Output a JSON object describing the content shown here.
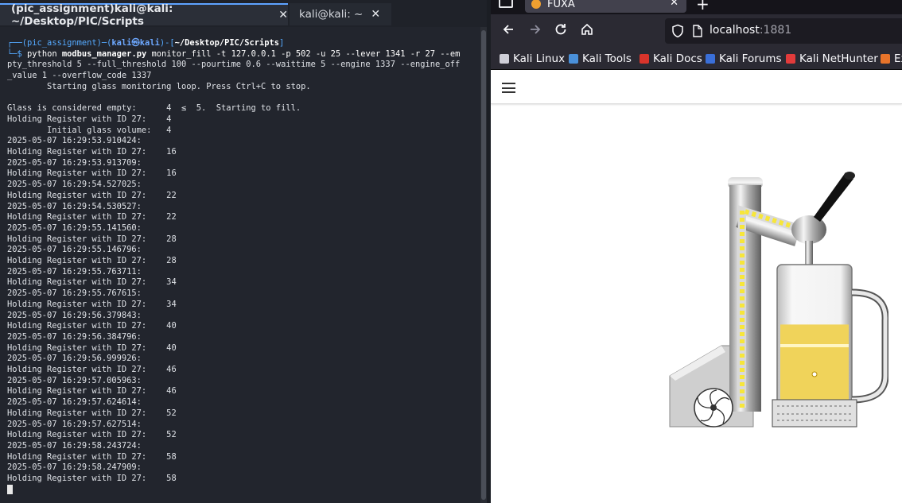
{
  "terminal": {
    "tabs": [
      {
        "label": "(pic_assignment)kali@kali: ~/Desktop/PIC/Scripts",
        "close": "✕"
      },
      {
        "label": "kali@kali: ~",
        "close": "✕"
      }
    ],
    "prompt": {
      "venv": "(pic_assignment)",
      "user": "kali㉿kali",
      "path": "~/Desktop/PIC/Scripts",
      "symbol": "$",
      "command_bin": "python",
      "command_script": "modbus_manager.py",
      "command_args_line1": " monitor_fill -t 127.0.0.1 -p 502 -u 25 --lever 1341 -r 27 --em",
      "command_line2": "pty_threshold 5 --full_threshold 100 --pourtime 0.6 --waittime 5 --engine 1337 --engine_off",
      "command_line3": "_value 1 --overflow_code 1337"
    },
    "output": [
      "        Starting glass monitoring loop. Press Ctrl+C to stop.",
      "",
      "Glass is considered empty:      4  ≤  5.  Starting to fill.",
      "Holding Register with ID 27:    4",
      "        Initial glass volume:   4",
      "2025-05-07 16:29:53.910424:",
      "Holding Register with ID 27:    16",
      "2025-05-07 16:29:53.913709:",
      "Holding Register with ID 27:    16",
      "2025-05-07 16:29:54.527025:",
      "Holding Register with ID 27:    22",
      "2025-05-07 16:29:54.530527:",
      "Holding Register with ID 27:    22",
      "2025-05-07 16:29:55.141560:",
      "Holding Register with ID 27:    28",
      "2025-05-07 16:29:55.146796:",
      "Holding Register with ID 27:    28",
      "2025-05-07 16:29:55.763711:",
      "Holding Register with ID 27:    34",
      "2025-05-07 16:29:55.767615:",
      "Holding Register with ID 27:    34",
      "2025-05-07 16:29:56.379843:",
      "Holding Register with ID 27:    40",
      "2025-05-07 16:29:56.384796:",
      "Holding Register with ID 27:    40",
      "2025-05-07 16:29:56.999926:",
      "Holding Register with ID 27:    46",
      "2025-05-07 16:29:57.005963:",
      "Holding Register with ID 27:    46",
      "2025-05-07 16:29:57.624614:",
      "Holding Register with ID 27:    52",
      "2025-05-07 16:29:57.627514:",
      "Holding Register with ID 27:    52",
      "2025-05-07 16:29:58.243724:",
      "Holding Register with ID 27:    58",
      "2025-05-07 16:29:58.247909:",
      "Holding Register with ID 27:    58"
    ]
  },
  "browser": {
    "tab_title": "FUXA",
    "tab_close": "✕",
    "new_tab": "+",
    "url_host": "localhost",
    "url_port": ":1881",
    "bookmarks": [
      {
        "label": "Kali Linux",
        "icon": "kali-dragon-icon",
        "color": "#cfcfd8"
      },
      {
        "label": "Kali Tools",
        "icon": "kali-tools-icon",
        "color": "#4a90d9"
      },
      {
        "label": "Kali Docs",
        "icon": "kali-docs-icon",
        "color": "#d9342b"
      },
      {
        "label": "Kali Forums",
        "icon": "kali-forums-icon",
        "color": "#3a6fd8"
      },
      {
        "label": "Kali NetHunter",
        "icon": "nethunter-icon",
        "color": "#e23b3b"
      },
      {
        "label": "Ex",
        "icon": "exploit-db-icon",
        "color": "#e8742a"
      }
    ],
    "hmi": {
      "glass_fill_fraction": 0.58,
      "beer_color": "#f0d35a",
      "led_color": "#f7e63a"
    }
  }
}
